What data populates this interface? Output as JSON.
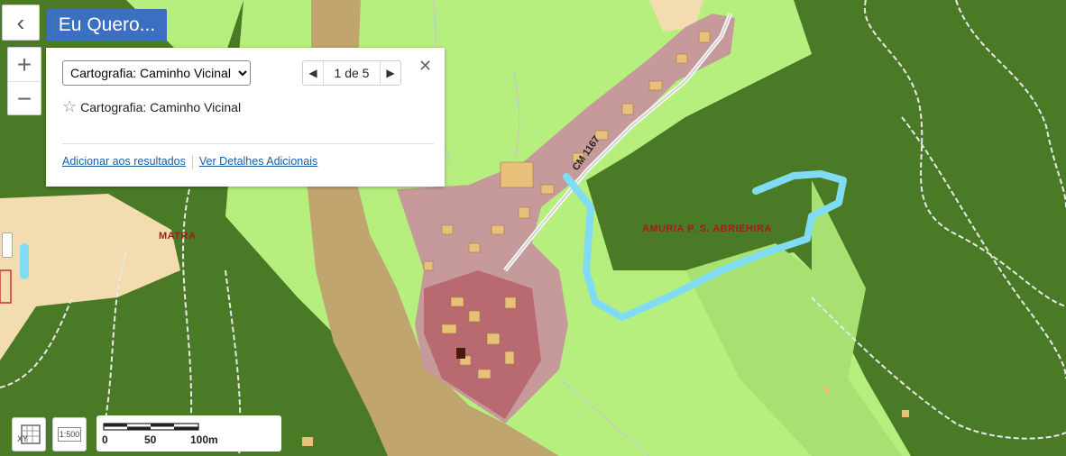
{
  "nav": {
    "back_icon": "chevron-left-icon",
    "want_label": "Eu Quero..."
  },
  "zoom": {
    "in_label": "+",
    "out_label": "−"
  },
  "popup": {
    "layer_select_value": "Cartografia: Caminho Vicinal",
    "pager_text": "1 de 5",
    "close_label": "✕",
    "feature_title": "Cartografia: Caminho Vicinal",
    "actions": [
      "Adicionar aos resultados",
      "Ver Detalhes Adicionais"
    ]
  },
  "map_labels": {
    "road": "CM 1167",
    "place1": "MATRA",
    "place2": "AMURIA P. S. ABRIEHIRA"
  },
  "scale": {
    "ticks": [
      "0",
      "50",
      "100m"
    ],
    "ratio": "1:500"
  },
  "colors": {
    "forest": "#4a7a25",
    "meadow": "#b6ef7e",
    "urban": "#c69a9a",
    "urban_dark": "#b96a70",
    "road_corridor": "#c1a56f",
    "beige": "#f5deb3",
    "river": "#7fdcf2",
    "accent_button": "#3b6fc0"
  }
}
